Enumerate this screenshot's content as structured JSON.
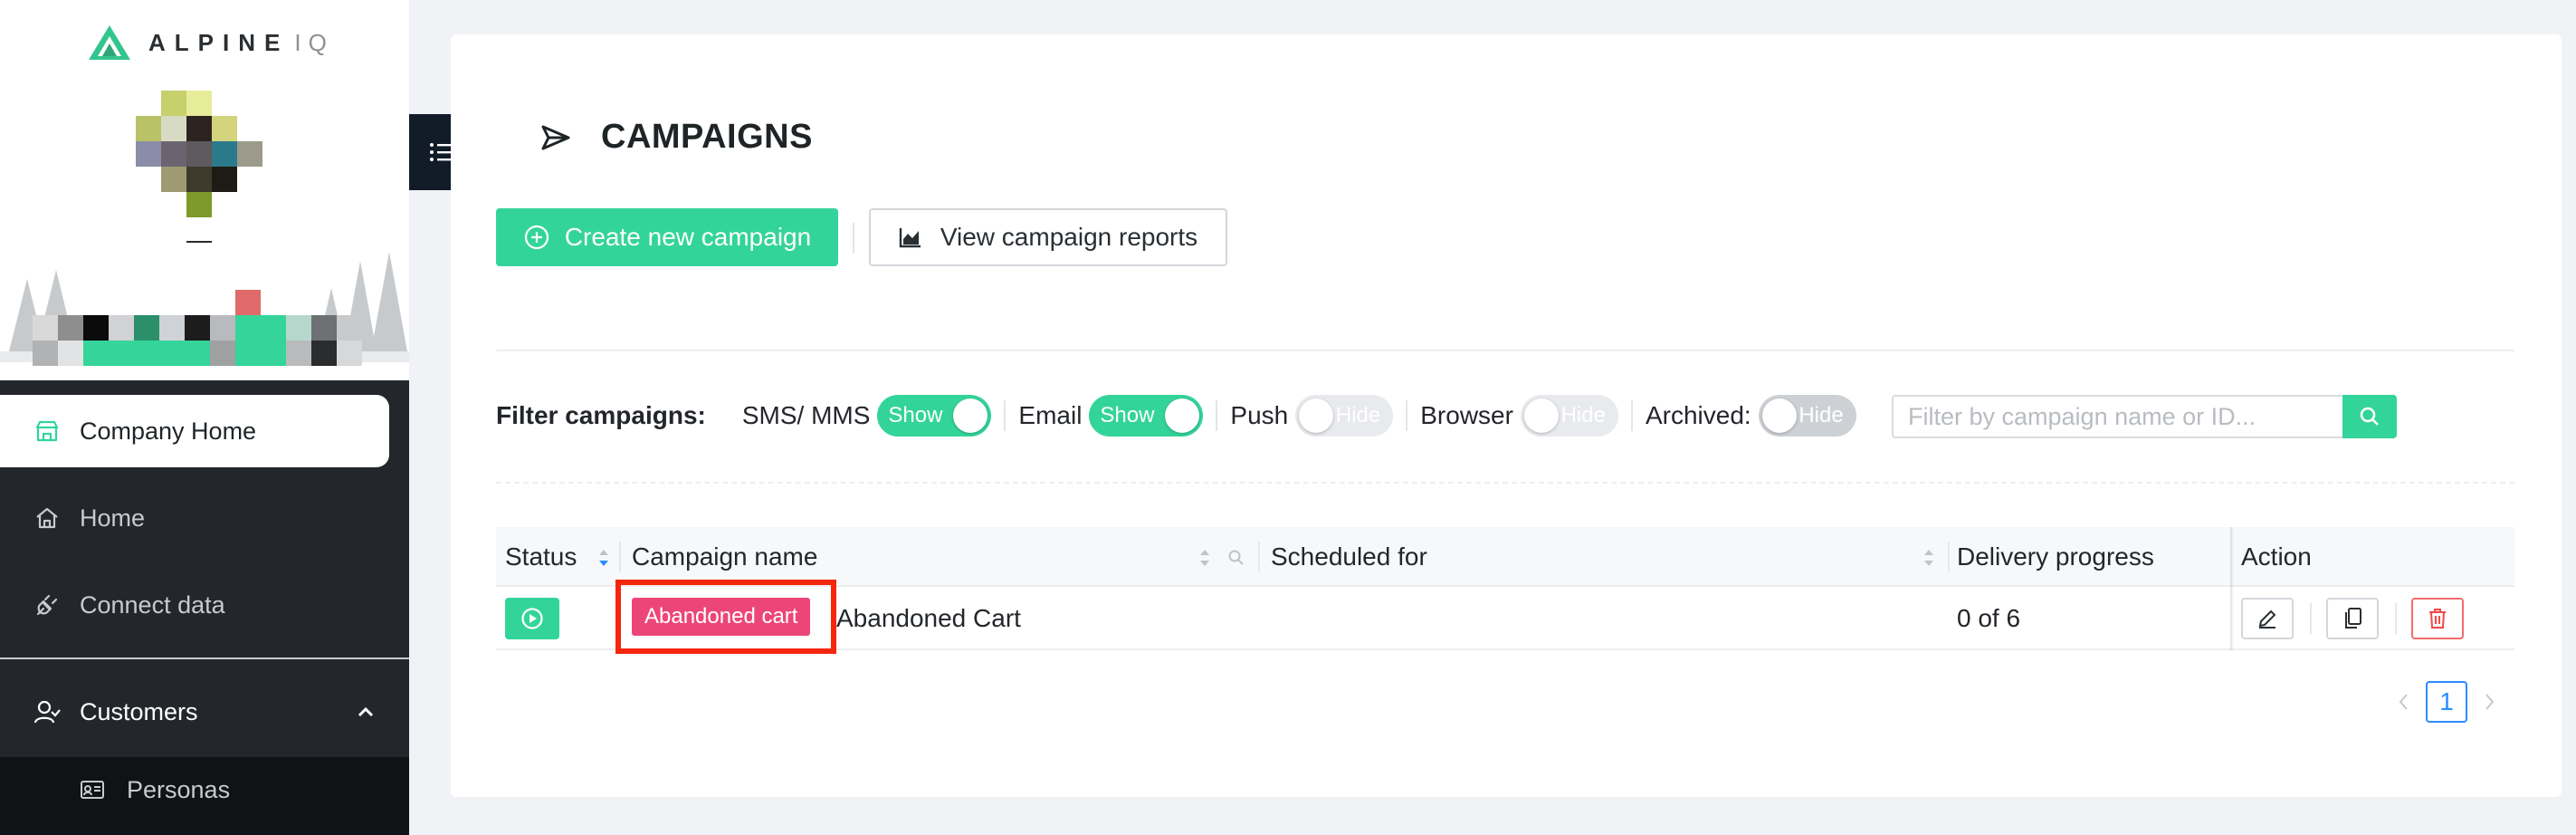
{
  "brand": {
    "name": "ALPINE",
    "suffix": "IQ"
  },
  "sidebar": {
    "items": [
      {
        "label": "Company Home",
        "icon": "store-icon",
        "active": true
      },
      {
        "label": "Home",
        "icon": "home-icon"
      },
      {
        "label": "Connect data",
        "icon": "plug-icon"
      },
      {
        "label": "Customers",
        "icon": "users-icon",
        "expanded": true
      }
    ],
    "sub_items": [
      {
        "label": "Personas",
        "icon": "id-card-icon"
      }
    ]
  },
  "page": {
    "title": "CAMPAIGNS"
  },
  "toolbar": {
    "create_label": "Create new campaign",
    "reports_label": "View campaign reports"
  },
  "filters": {
    "label": "Filter campaigns:",
    "channels": [
      {
        "label": "SMS/ MMS",
        "state": "Show",
        "on": true
      },
      {
        "label": "Email",
        "state": "Show",
        "on": true
      },
      {
        "label": "Push",
        "state": "Hide",
        "on": false
      },
      {
        "label": "Browser",
        "state": "Hide",
        "on": false
      }
    ],
    "archived": {
      "label": "Archived:",
      "state": "Hide",
      "on": false
    },
    "search_placeholder": "Filter by campaign name or ID..."
  },
  "table": {
    "columns": [
      "Status",
      "Campaign name",
      "Scheduled for",
      "Delivery progress",
      "Action"
    ],
    "rows": [
      {
        "status": "play",
        "tag": "Abandoned cart",
        "name": "Abandoned Cart",
        "scheduled": "",
        "progress": "0 of 6"
      }
    ]
  },
  "pagination": {
    "current": "1"
  },
  "colors": {
    "accent": "#33d49a",
    "tag": "#ec4678",
    "highlight": "#f5260e",
    "sidebar": "#23262b",
    "link": "#2a8dff"
  }
}
